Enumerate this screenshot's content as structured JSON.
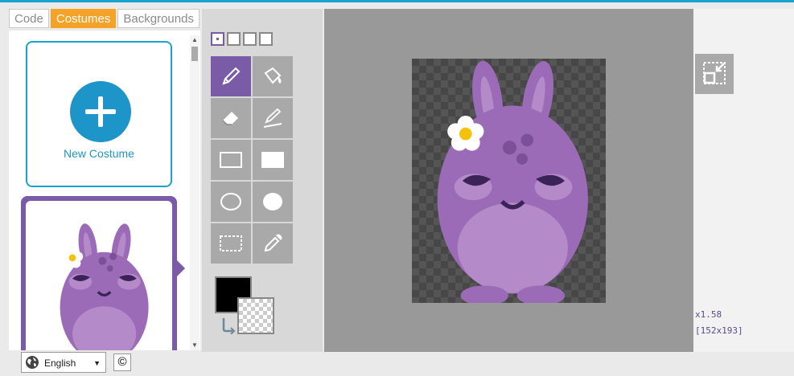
{
  "tabs": [
    {
      "label": "Code",
      "active": false
    },
    {
      "label": "Costumes",
      "active": true
    },
    {
      "label": "Backgrounds",
      "active": false
    }
  ],
  "costume_list": {
    "new_costume_label": "New Costume",
    "items": [
      {
        "selected": true,
        "icon": "purple-bunny-costume"
      }
    ]
  },
  "footer": {
    "language": "English",
    "copyright_symbol": "©"
  },
  "tools": {
    "brush_sizes": [
      "smallest",
      "small",
      "medium",
      "large"
    ],
    "selected_brush_size": "smallest",
    "items": [
      "pencil",
      "paint-bucket",
      "eraser",
      "line",
      "rectangle-outline",
      "rectangle-filled",
      "ellipse-outline",
      "ellipse-filled",
      "select",
      "eyedropper"
    ],
    "selected": "pencil",
    "foreground_color": "#000000",
    "background_color": "transparent"
  },
  "canvas": {
    "zoom_label": "x1.58",
    "size_label": "[152x193]"
  },
  "colors": {
    "accent": "#f4a228",
    "selection": "#7a5ba8",
    "link": "#1d95c9"
  }
}
